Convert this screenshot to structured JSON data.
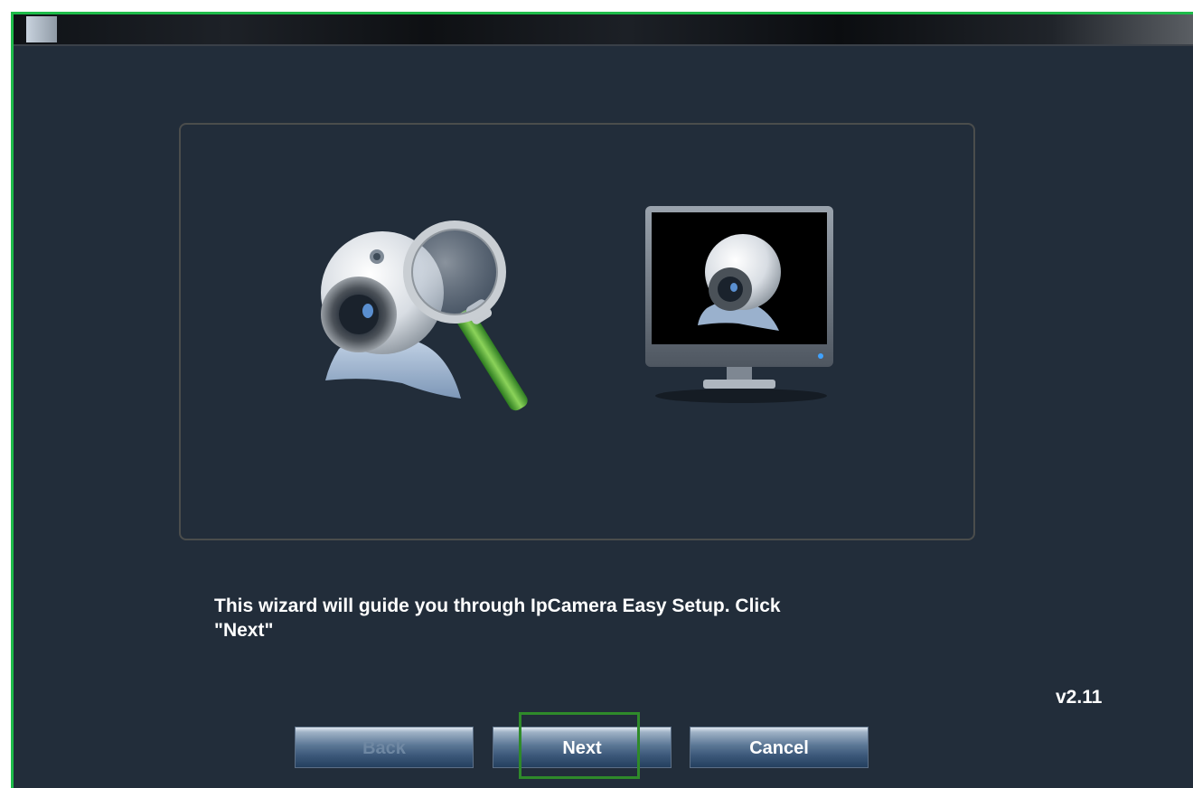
{
  "window": {
    "title": ""
  },
  "illustrations": {
    "left": "webcam-search-icon",
    "right": "monitor-webcam-icon"
  },
  "message": "This wizard will guide you through IpCamera Easy Setup. Click\n\"Next\"",
  "version": "v2.11",
  "buttons": {
    "back": "Back",
    "next": "Next",
    "cancel": "Cancel"
  },
  "colors": {
    "background": "#222d3a",
    "accent_border": "#1ebc4a",
    "highlight": "#2f8a2a"
  }
}
